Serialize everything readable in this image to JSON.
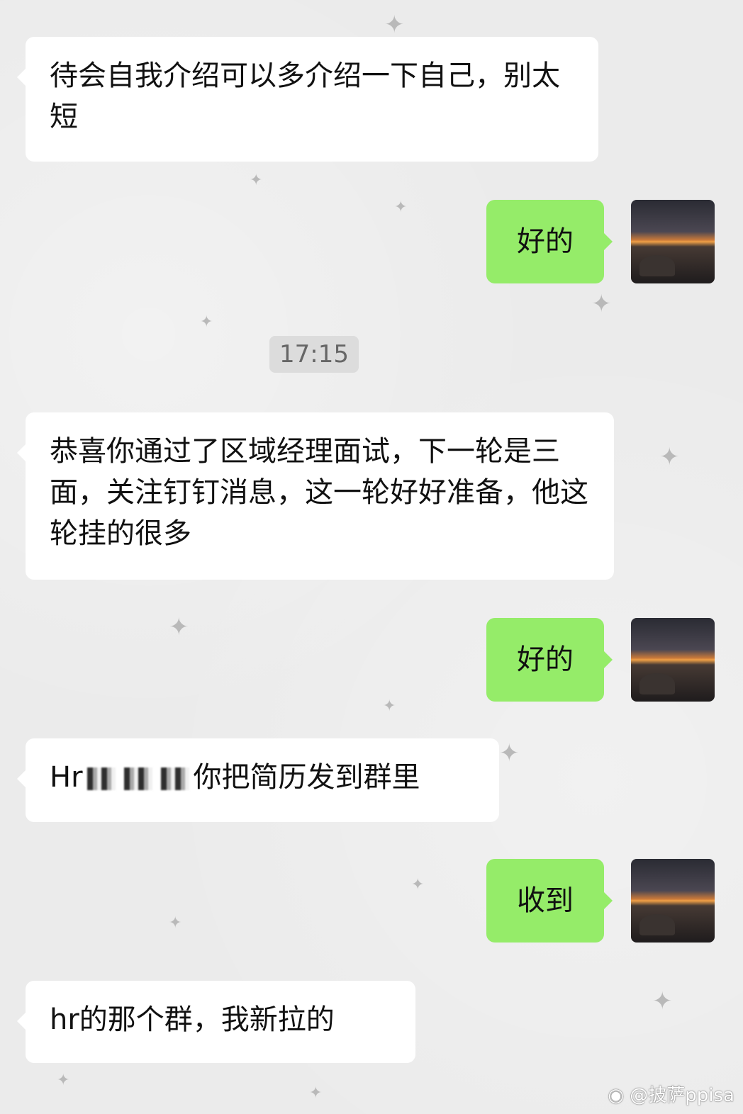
{
  "chat": {
    "messages": [
      {
        "side": "received",
        "text": "待会自我介绍可以多介绍一下自己，别太短"
      },
      {
        "side": "sent",
        "text": "好的"
      },
      {
        "side": "received",
        "text": "恭喜你通过了区域经理面试，下一轮是三面，关注钉钉消息，这一轮好好准备，他这轮挂的很多"
      },
      {
        "side": "sent",
        "text": "好的"
      },
      {
        "side": "received",
        "prefix": "Hr",
        "text": "你把简历发到群里",
        "redacted": true
      },
      {
        "side": "sent",
        "text": "收到"
      },
      {
        "side": "received",
        "text": "hr的那个群，我新拉的"
      }
    ],
    "timestamp": "17:15"
  },
  "watermark": "@披萨ppisa",
  "colors": {
    "sent_bubble": "#95ec69",
    "received_bubble": "#ffffff",
    "background": "#ebebeb"
  },
  "icons": [
    "star-decoration-icon",
    "weibo-logo-icon"
  ]
}
